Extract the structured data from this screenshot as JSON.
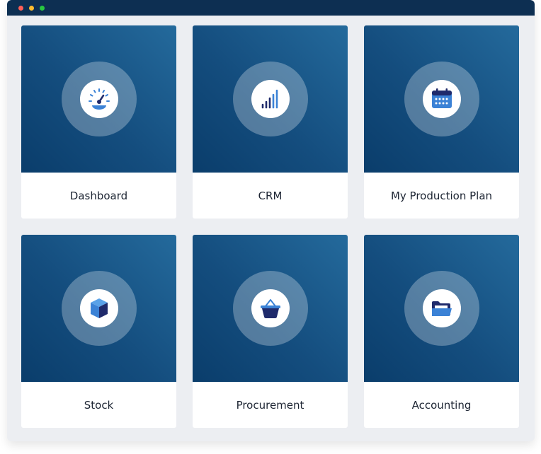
{
  "window": {
    "titlebar_buttons": [
      "close",
      "minimize",
      "maximize"
    ]
  },
  "tiles": [
    {
      "label": "Dashboard",
      "icon": "speedometer-icon"
    },
    {
      "label": "CRM",
      "icon": "bar-chart-icon"
    },
    {
      "label": "My Production Plan",
      "icon": "calendar-icon"
    },
    {
      "label": "Stock",
      "icon": "cube-icon"
    },
    {
      "label": "Procurement",
      "icon": "basket-icon"
    },
    {
      "label": "Accounting",
      "icon": "folder-icon"
    }
  ],
  "colors": {
    "titlebar": "#0d2f52",
    "tile_gradient_dark": "#0a3d6b",
    "tile_gradient_light": "#246a9c",
    "background": "#eceef2",
    "icon_blue": "#3b82d6",
    "icon_navy": "#1f2a6b"
  }
}
